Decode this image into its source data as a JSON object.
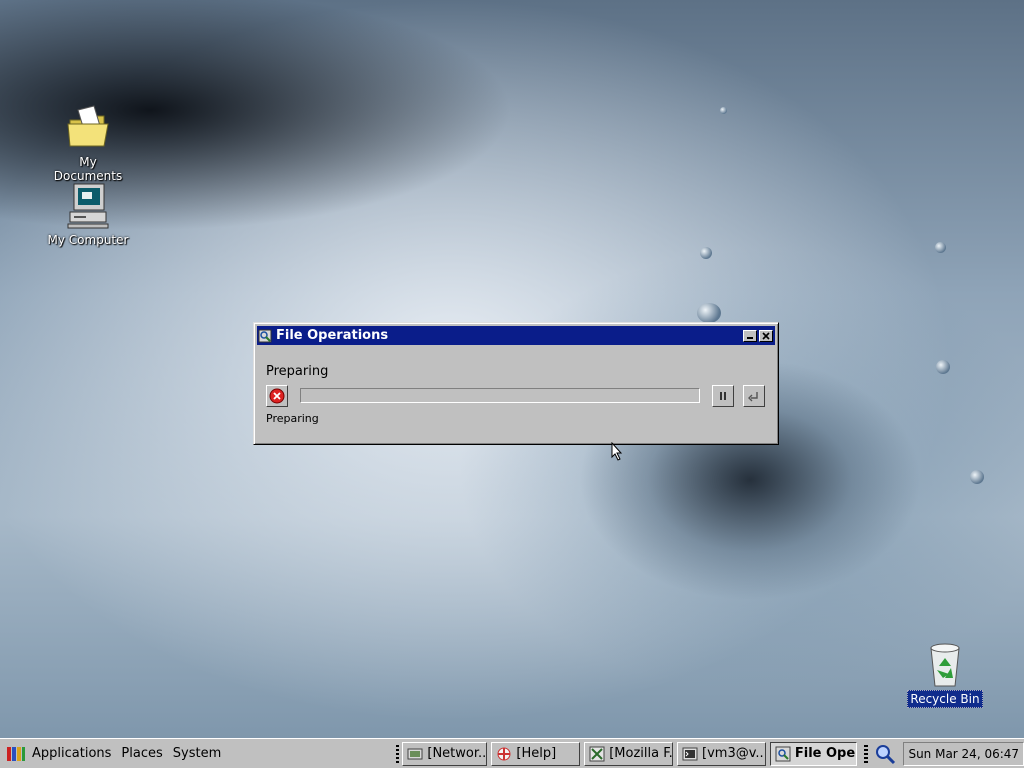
{
  "desktop": {
    "icons": [
      {
        "label": "My Documents",
        "icon": "folder-icon"
      },
      {
        "label": "My Computer",
        "icon": "computer-icon"
      },
      {
        "label": "Recycle Bin",
        "icon": "recycle-bin-icon"
      }
    ]
  },
  "dialog": {
    "title": "File Operations",
    "heading": "Preparing",
    "status": "Preparing",
    "progress": 0,
    "buttons": {
      "minimize": "minimize-icon",
      "close": "close-icon",
      "stop": "stop-icon",
      "pause": "pause-icon",
      "undo": "undo-icon"
    }
  },
  "taskbar": {
    "menus": [
      "Applications",
      "Places",
      "System"
    ],
    "tasks": [
      {
        "label": "[Networ...",
        "icon": "network-icon",
        "active": false
      },
      {
        "label": "[Help]",
        "icon": "help-icon",
        "active": false
      },
      {
        "label": "[Mozilla F...",
        "icon": "browser-icon",
        "active": false
      },
      {
        "label": "[vm3@v...",
        "icon": "terminal-icon",
        "active": false
      },
      {
        "label": "File Oper...",
        "icon": "file-manager-icon",
        "active": true
      }
    ],
    "clock": "Sun Mar 24, 06:47"
  },
  "colors": {
    "titlebar": "#0a1d8a",
    "window": "#c0c0c0",
    "selection": "#102c8c"
  }
}
